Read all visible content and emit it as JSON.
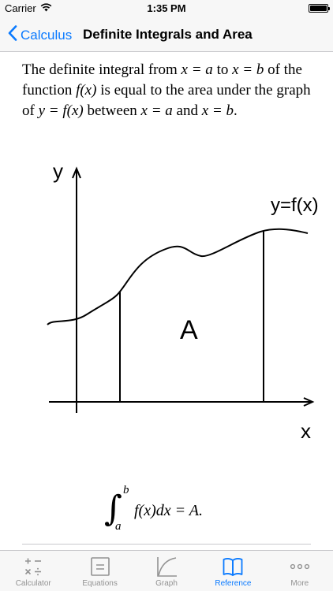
{
  "status": {
    "carrier": "Carrier",
    "time": "1:35 PM"
  },
  "nav": {
    "back_label": "Calculus",
    "title": "Definite Integrals and Area"
  },
  "intro": {
    "p1": "The definite integral from ",
    "x_eq_a": "x = a",
    "p2": " to ",
    "x_eq_b": "x = b",
    "p3": " of the function ",
    "fx": "f(x)",
    "p4": " is equal to the area under the graph of ",
    "y_eq_fx": "y = f(x)",
    "p5": " between ",
    "x_eq_a2": "x = a",
    "p6": " and ",
    "x_eq_b2": "x = b",
    "p7": "."
  },
  "graph": {
    "y_axis_label": "y",
    "x_axis_label": "x",
    "curve_label": "y=f(x)",
    "area_label": "A"
  },
  "formula": {
    "upper": "b",
    "lower": "a",
    "body": "f(x)dx = A."
  },
  "tabs": [
    {
      "label": "Calculator",
      "icon": "calculator-icon"
    },
    {
      "label": "Equations",
      "icon": "equations-icon"
    },
    {
      "label": "Graph",
      "icon": "graph-icon"
    },
    {
      "label": "Reference",
      "icon": "book-icon"
    },
    {
      "label": "More",
      "icon": "more-icon"
    }
  ],
  "colors": {
    "accent": "#0a7aff",
    "inactive": "#929292",
    "bar": "#f7f7f7"
  }
}
